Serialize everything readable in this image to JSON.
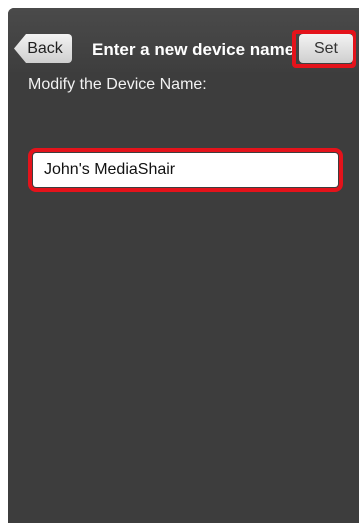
{
  "navbar": {
    "back_label": "Back",
    "title": "Enter a new device name",
    "set_label": "Set"
  },
  "form": {
    "label": "Modify the Device Name:",
    "device_name_value": "John's MediaShair"
  },
  "colors": {
    "background": "#3d3d3d",
    "highlight": "#e4131b"
  }
}
